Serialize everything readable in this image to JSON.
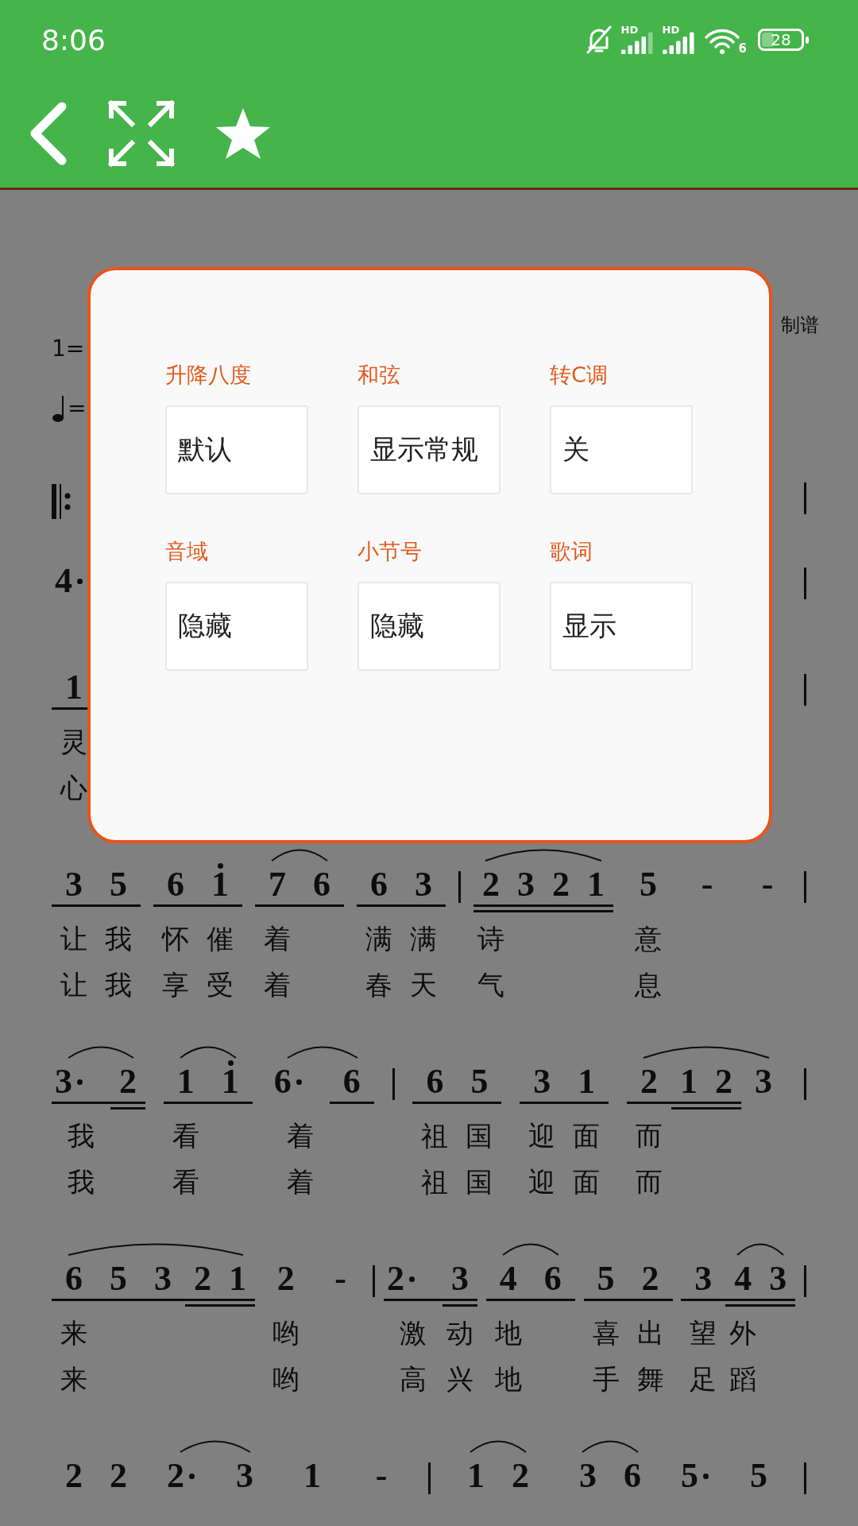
{
  "status_bar": {
    "time": "8:06",
    "sim_1": "HD",
    "sim_2": "HD",
    "wifi_badge": "6",
    "battery": "28"
  },
  "score": {
    "composer": "制谱",
    "key": "1=",
    "tempo": "=",
    "rows": [
      {
        "items": [
          {
            "kind": "repeat"
          },
          {
            "kind": "bar"
          }
        ]
      },
      {
        "items": [
          {
            "kind": "group",
            "notes": [
              {
                "kind": "quarter",
                "digit": "4",
                "dot": true
              }
            ]
          },
          {
            "kind": "bar"
          }
        ]
      },
      {
        "items": [
          {
            "kind": "group",
            "notes": [
              {
                "kind": "eighth",
                "digit": "1",
                "lyrics": [
                  "灵",
                  "心"
                ]
              }
            ]
          },
          {
            "kind": "bar"
          }
        ]
      },
      {
        "items": [
          {
            "kind": "group",
            "notes": [
              {
                "kind": "eighth",
                "digit": "3",
                "lyrics": [
                  "让",
                  "让"
                ]
              },
              {
                "kind": "eighth",
                "digit": "5",
                "lyrics": [
                  "我",
                  "我"
                ]
              }
            ]
          },
          {
            "kind": "group",
            "notes": [
              {
                "kind": "eighth",
                "digit": "6",
                "lyrics": [
                  "怀",
                  "享"
                ]
              },
              {
                "kind": "eighth",
                "digit": "1",
                "high": true,
                "lyrics": [
                  "催",
                  "受"
                ]
              }
            ]
          },
          {
            "kind": "group",
            "notes": [
              {
                "kind": "eighth",
                "digit": "7",
                "slur": true,
                "lyrics": [
                  "着",
                  "着"
                ]
              },
              {
                "kind": "eighth",
                "digit": "6",
                "slur": true
              }
            ]
          },
          {
            "kind": "group",
            "notes": [
              {
                "kind": "eighth",
                "digit": "6",
                "lyrics": [
                  "满",
                  "春"
                ]
              },
              {
                "kind": "eighth",
                "digit": "3",
                "lyrics": [
                  "满",
                  "天"
                ]
              }
            ]
          },
          {
            "kind": "bar"
          },
          {
            "kind": "group",
            "notes": [
              {
                "kind": "sixteenth",
                "digit": "2",
                "slur": true,
                "lyrics": [
                  "诗",
                  "气"
                ]
              },
              {
                "kind": "sixteenth",
                "digit": "3",
                "slur": true
              },
              {
                "kind": "sixteenth",
                "digit": "2",
                "slur": true
              },
              {
                "kind": "sixteenth",
                "digit": "1",
                "slur": true
              }
            ]
          },
          {
            "kind": "group",
            "notes": [
              {
                "kind": "quarter",
                "digit": "5",
                "lyrics": [
                  "意",
                  "息"
                ]
              }
            ]
          },
          {
            "kind": "dash",
            "text": "-"
          },
          {
            "kind": "dash",
            "text": "-"
          },
          {
            "kind": "bar"
          }
        ]
      },
      {
        "items": [
          {
            "kind": "group",
            "notes": [
              {
                "kind": "eighth",
                "digit": "3",
                "dot": true,
                "slur": true,
                "lyrics": [
                  "我",
                  "我"
                ]
              },
              {
                "kind": "sixteenth",
                "digit": "2",
                "slur": true
              }
            ]
          },
          {
            "kind": "group",
            "notes": [
              {
                "kind": "eighth",
                "digit": "1",
                "slur": true,
                "lyrics": [
                  "看",
                  "看"
                ]
              },
              {
                "kind": "eighth",
                "digit": "1",
                "high": true,
                "slur": true
              }
            ]
          },
          {
            "kind": "group",
            "notes": [
              {
                "kind": "quarter",
                "digit": "6",
                "dot": true,
                "slur": true,
                "lyrics": [
                  "着",
                  "着"
                ]
              },
              {
                "kind": "eighth",
                "digit": "6",
                "slur": true
              }
            ]
          },
          {
            "kind": "bar"
          },
          {
            "kind": "group",
            "notes": [
              {
                "kind": "eighth",
                "digit": "6",
                "lyrics": [
                  "祖",
                  "祖"
                ]
              },
              {
                "kind": "eighth",
                "digit": "5",
                "lyrics": [
                  "国",
                  "国"
                ]
              }
            ]
          },
          {
            "kind": "group",
            "notes": [
              {
                "kind": "eighth",
                "digit": "3",
                "lyrics": [
                  "迎",
                  "迎"
                ]
              },
              {
                "kind": "eighth",
                "digit": "1",
                "lyrics": [
                  "面",
                  "面"
                ]
              }
            ]
          },
          {
            "kind": "group",
            "notes": [
              {
                "kind": "eighth",
                "digit": "2",
                "slur": true,
                "lyrics": [
                  "而",
                  "而"
                ]
              },
              {
                "kind": "sixteenth",
                "digit": "1",
                "slur": true
              },
              {
                "kind": "sixteenth",
                "digit": "2",
                "slur": true
              },
              {
                "kind": "quarter",
                "digit": "3",
                "slur": true
              }
            ]
          },
          {
            "kind": "bar"
          }
        ]
      },
      {
        "items": [
          {
            "kind": "group",
            "notes": [
              {
                "kind": "eighth",
                "digit": "6",
                "slur": true,
                "lyrics": [
                  "来",
                  "来"
                ]
              },
              {
                "kind": "eighth",
                "digit": "5",
                "slur": true
              },
              {
                "kind": "eighth",
                "digit": "3",
                "slur": true
              },
              {
                "kind": "sixteenth",
                "digit": "2",
                "slur": true
              },
              {
                "kind": "sixteenth",
                "digit": "1",
                "slur": true
              }
            ]
          },
          {
            "kind": "group",
            "notes": [
              {
                "kind": "quarter",
                "digit": "2",
                "lyrics": [
                  "哟",
                  "哟"
                ]
              }
            ]
          },
          {
            "kind": "dash",
            "text": "-"
          },
          {
            "kind": "bar"
          },
          {
            "kind": "group",
            "notes": [
              {
                "kind": "eighth",
                "digit": "2",
                "dot": true,
                "lyrics": [
                  "激",
                  "高"
                ]
              },
              {
                "kind": "sixteenth",
                "digit": "3",
                "lyrics": [
                  "动",
                  "兴"
                ]
              }
            ]
          },
          {
            "kind": "group",
            "notes": [
              {
                "kind": "eighth",
                "digit": "4",
                "slur": true,
                "lyrics": [
                  "地",
                  "地"
                ]
              },
              {
                "kind": "eighth",
                "digit": "6",
                "slur": true
              }
            ]
          },
          {
            "kind": "group",
            "notes": [
              {
                "kind": "eighth",
                "digit": "5",
                "lyrics": [
                  "喜",
                  "手"
                ]
              },
              {
                "kind": "eighth",
                "digit": "2",
                "lyrics": [
                  "出",
                  "舞"
                ]
              }
            ]
          },
          {
            "kind": "group",
            "notes": [
              {
                "kind": "eighth",
                "digit": "3",
                "lyrics": [
                  "望",
                  "足"
                ]
              },
              {
                "kind": "sixteenth",
                "digit": "4",
                "slur": true,
                "lyrics": [
                  "外",
                  "蹈"
                ]
              },
              {
                "kind": "sixteenth",
                "digit": "3",
                "slur": true
              }
            ]
          },
          {
            "kind": "bar"
          }
        ]
      },
      {
        "items": [
          {
            "kind": "group",
            "notes": [
              {
                "kind": "quarter",
                "digit": "2"
              },
              {
                "kind": "quarter",
                "digit": "2"
              }
            ]
          },
          {
            "kind": "group",
            "notes": [
              {
                "kind": "quarter",
                "digit": "2",
                "dot": true,
                "slur": true
              },
              {
                "kind": "quarter",
                "digit": "3",
                "slur": true
              }
            ]
          },
          {
            "kind": "group",
            "notes": [
              {
                "kind": "quarter",
                "digit": "1"
              }
            ]
          },
          {
            "kind": "dash",
            "text": "-"
          },
          {
            "kind": "bar"
          },
          {
            "kind": "group",
            "notes": [
              {
                "kind": "quarter",
                "digit": "1",
                "slur": true
              },
              {
                "kind": "quarter",
                "digit": "2",
                "slur": true
              }
            ]
          },
          {
            "kind": "group",
            "notes": [
              {
                "kind": "quarter",
                "digit": "3",
                "slur": true
              },
              {
                "kind": "quarter",
                "digit": "6",
                "slur": true
              }
            ]
          },
          {
            "kind": "group",
            "notes": [
              {
                "kind": "quarter",
                "digit": "5",
                "dot": true
              },
              {
                "kind": "quarter",
                "digit": "5"
              }
            ]
          },
          {
            "kind": "bar"
          }
        ]
      }
    ]
  },
  "dialog": {
    "settings": [
      {
        "label": "升降八度",
        "value": "默认"
      },
      {
        "label": "和弦",
        "value": "显示常规"
      },
      {
        "label": "转C调",
        "value": "关"
      },
      {
        "label": "音域",
        "value": "隐藏"
      },
      {
        "label": "小节号",
        "value": "隐藏"
      },
      {
        "label": "歌词",
        "value": "显示"
      }
    ]
  }
}
